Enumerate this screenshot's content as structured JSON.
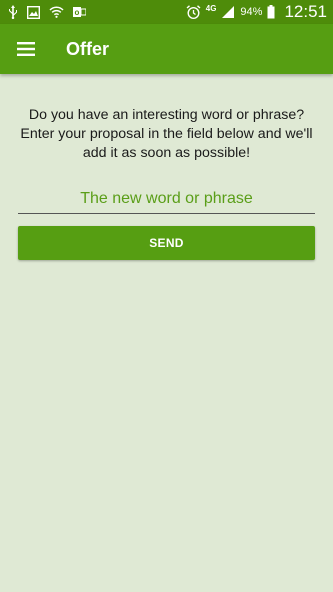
{
  "status_bar": {
    "network": "4G",
    "battery": "94%",
    "time": "12:51",
    "icons": [
      "usb-icon",
      "gallery-icon",
      "wifi-icon",
      "outlook-icon",
      "alarm-icon",
      "signal-icon",
      "battery-icon"
    ]
  },
  "app_bar": {
    "title": "Offer",
    "menu_icon": "hamburger-menu-icon",
    "background": "#569e12"
  },
  "main": {
    "description": "Do you have an interesting word or phrase? Enter your proposal in the field below and we'll add it as soon as possible!",
    "input_placeholder": "The new word or phrase",
    "input_value": "",
    "send_label": "SEND"
  },
  "colors": {
    "status_bar": "#4e8c0a",
    "accent": "#569e12",
    "page_background": "#dfe9d4",
    "placeholder": "#5a9e18"
  }
}
